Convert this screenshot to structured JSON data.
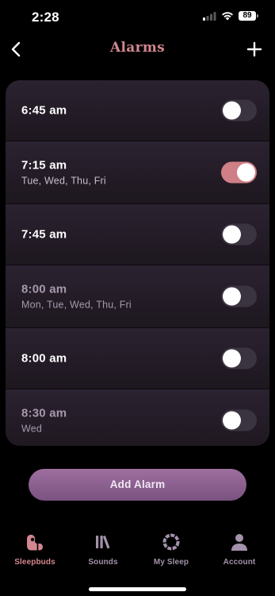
{
  "status_bar": {
    "time": "2:28",
    "battery": "89"
  },
  "header": {
    "title": "Alarms",
    "back_icon": "chevron-left-icon",
    "add_icon": "plus-icon"
  },
  "alarms": [
    {
      "time": "6:45 am",
      "days": "",
      "enabled": false
    },
    {
      "time": "7:15 am",
      "days": "Tue, Wed, Thu, Fri",
      "enabled": true
    },
    {
      "time": "7:45 am",
      "days": "",
      "enabled": false
    },
    {
      "time": "8:00 am",
      "days": "Mon, Tue, Wed, Thu, Fri",
      "enabled": false
    },
    {
      "time": "8:00 am",
      "days": "",
      "enabled": false
    },
    {
      "time": "8:30 am",
      "days": "Wed",
      "enabled": false
    }
  ],
  "add_alarm_label": "Add Alarm",
  "tabs": [
    {
      "label": "Sleepbuds",
      "icon": "sleepbuds-icon",
      "active": true
    },
    {
      "label": "Sounds",
      "icon": "sounds-library-icon",
      "active": false
    },
    {
      "label": "My Sleep",
      "icon": "sleep-ring-icon",
      "active": false
    },
    {
      "label": "Account",
      "icon": "account-person-icon",
      "active": false
    }
  ],
  "colors": {
    "accent": "#d2868f",
    "toggle_on": "#cf7f86",
    "button": "#8a5f8f",
    "tab_inactive": "#a392aa"
  }
}
